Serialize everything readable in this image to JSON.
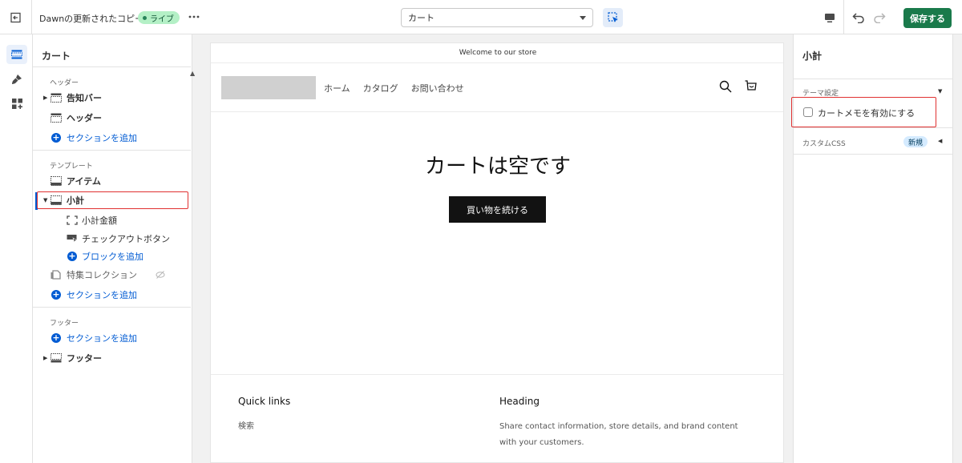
{
  "topbar": {
    "theme_name": "Dawnの更新されたコピー",
    "live_badge": "ライブ",
    "page_select_value": "カート",
    "save_label": "保存する"
  },
  "sidebar": {
    "title": "カート",
    "header_group": {
      "label": "ヘッダー",
      "items": [
        "告知バー",
        "ヘッダー"
      ],
      "add_section": "セクションを追加"
    },
    "template_group": {
      "label": "テンプレート",
      "items": [
        "アイテム",
        "小計"
      ],
      "subtotal_blocks": [
        "小計金額",
        "チェックアウトボタン"
      ],
      "add_block": "ブロックを追加",
      "featured_collection": "特集コレクション",
      "add_section": "セクションを追加"
    },
    "footer_group": {
      "label": "フッター",
      "add_section": "セクションを追加",
      "items": [
        "フッター"
      ]
    }
  },
  "preview": {
    "announcement": "Welcome to our store",
    "nav": [
      "ホーム",
      "カタログ",
      "お問い合わせ"
    ],
    "empty_title": "カートは空です",
    "continue_button": "買い物を続ける",
    "footer": {
      "quick_links_heading": "Quick links",
      "quick_links": [
        "検索"
      ],
      "heading": "Heading",
      "text_line1": "Share contact information, store details, and brand content",
      "text_line2": "with your customers."
    }
  },
  "right_panel": {
    "title": "小計",
    "theme_settings_label": "テーマ設定",
    "checkbox_label": "カートメモを有効にする",
    "checkbox_checked": false,
    "custom_css_label": "カスタムCSS",
    "new_badge": "新規"
  },
  "colors": {
    "accent_blue": "#005bd3",
    "save_green": "#1a7a4b",
    "highlight_red": "#e03131",
    "live_badge_bg": "#b4f0c6"
  }
}
